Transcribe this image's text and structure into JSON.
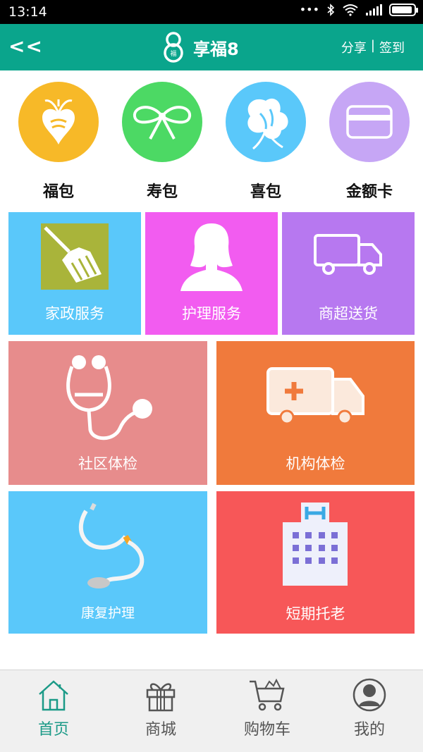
{
  "status_bar": {
    "time": "13:14",
    "dots": "•••",
    "icons": [
      "bluetooth-icon",
      "wifi-icon",
      "signal-icon",
      "battery-icon"
    ]
  },
  "header": {
    "back_label": "<<",
    "title": "享福8",
    "share_label": "分享",
    "separator": "|",
    "signin_label": "签到",
    "bg_color": "#0aa58c"
  },
  "categories": [
    {
      "label": "福包",
      "icon": "heart-ornament-icon",
      "color": "#f7b928"
    },
    {
      "label": "寿包",
      "icon": "bow-icon",
      "color": "#4cd964"
    },
    {
      "label": "喜包",
      "icon": "flower-icon",
      "color": "#5ac8fa"
    },
    {
      "label": "金额卡",
      "icon": "card-icon",
      "color": "#c6a6f5"
    }
  ],
  "services": [
    {
      "label": "家政服务",
      "icon": "broom-icon",
      "color": "#5ac8fa"
    },
    {
      "label": "护理服务",
      "icon": "woman-icon",
      "color": "#f25cf0"
    },
    {
      "label": "商超送货",
      "icon": "delivery-truck-icon",
      "color": "#b778f0"
    },
    {
      "label": "社区体检",
      "icon": "stethoscope-icon",
      "color": "#e78c8c"
    },
    {
      "label": "机构体检",
      "icon": "ambulance-icon",
      "color": "#f07a3c"
    },
    {
      "label": "康复护理",
      "icon": "stethoscope-color-icon",
      "color": "#5ac8fa"
    },
    {
      "label": "短期托老",
      "icon": "hospital-building-icon",
      "color": "#f75758"
    }
  ],
  "bottom_nav": [
    {
      "label": "首页",
      "icon": "home-icon",
      "active": true
    },
    {
      "label": "商城",
      "icon": "gift-icon",
      "active": false
    },
    {
      "label": "购物车",
      "icon": "cart-icon",
      "active": false
    },
    {
      "label": "我的",
      "icon": "user-avatar-icon",
      "active": false
    }
  ],
  "colors": {
    "nav_active": "#1b9a87",
    "nav_inactive": "#555555"
  }
}
